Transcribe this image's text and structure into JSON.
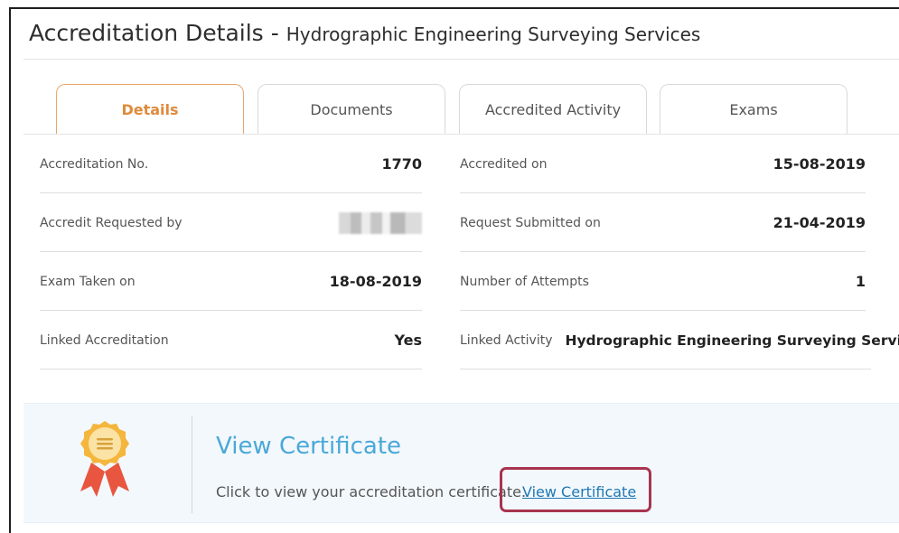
{
  "header": {
    "title": "Accreditation Details",
    "separator": "-",
    "subtitle": "Hydrographic Engineering Surveying Services"
  },
  "tabs": [
    {
      "label": "Details",
      "active": true
    },
    {
      "label": "Documents",
      "active": false
    },
    {
      "label": "Accredited Activity",
      "active": false
    },
    {
      "label": "Exams",
      "active": false
    }
  ],
  "details": {
    "accreditation_no": {
      "label": "Accreditation No.",
      "value": "1770"
    },
    "accredited_on": {
      "label": "Accredited on",
      "value": "15-08-2019"
    },
    "requested_by": {
      "label": "Accredit Requested by",
      "value_hidden": true
    },
    "request_submitted_on": {
      "label": "Request Submitted on",
      "value": "21-04-2019"
    },
    "exam_taken_on": {
      "label": "Exam Taken on",
      "value": "18-08-2019"
    },
    "number_of_attempts": {
      "label": "Number of Attempts",
      "value": "1"
    },
    "linked_accreditation": {
      "label": "Linked Accreditation",
      "value": "Yes"
    },
    "linked_activity": {
      "label": "Linked Activity",
      "value": "Hydrographic Engineering Surveying Services"
    }
  },
  "certificate": {
    "heading": "View Certificate",
    "text": "Click to view your accreditation certificate.",
    "link_label": "View Certificate",
    "icon": "award-ribbon-icon"
  },
  "colors": {
    "active_tab": "#e08a3c",
    "link": "#1f78b4",
    "heading": "#4aa8d8",
    "highlight": "#a8344f",
    "panel_bg": "#f3f8fc"
  }
}
